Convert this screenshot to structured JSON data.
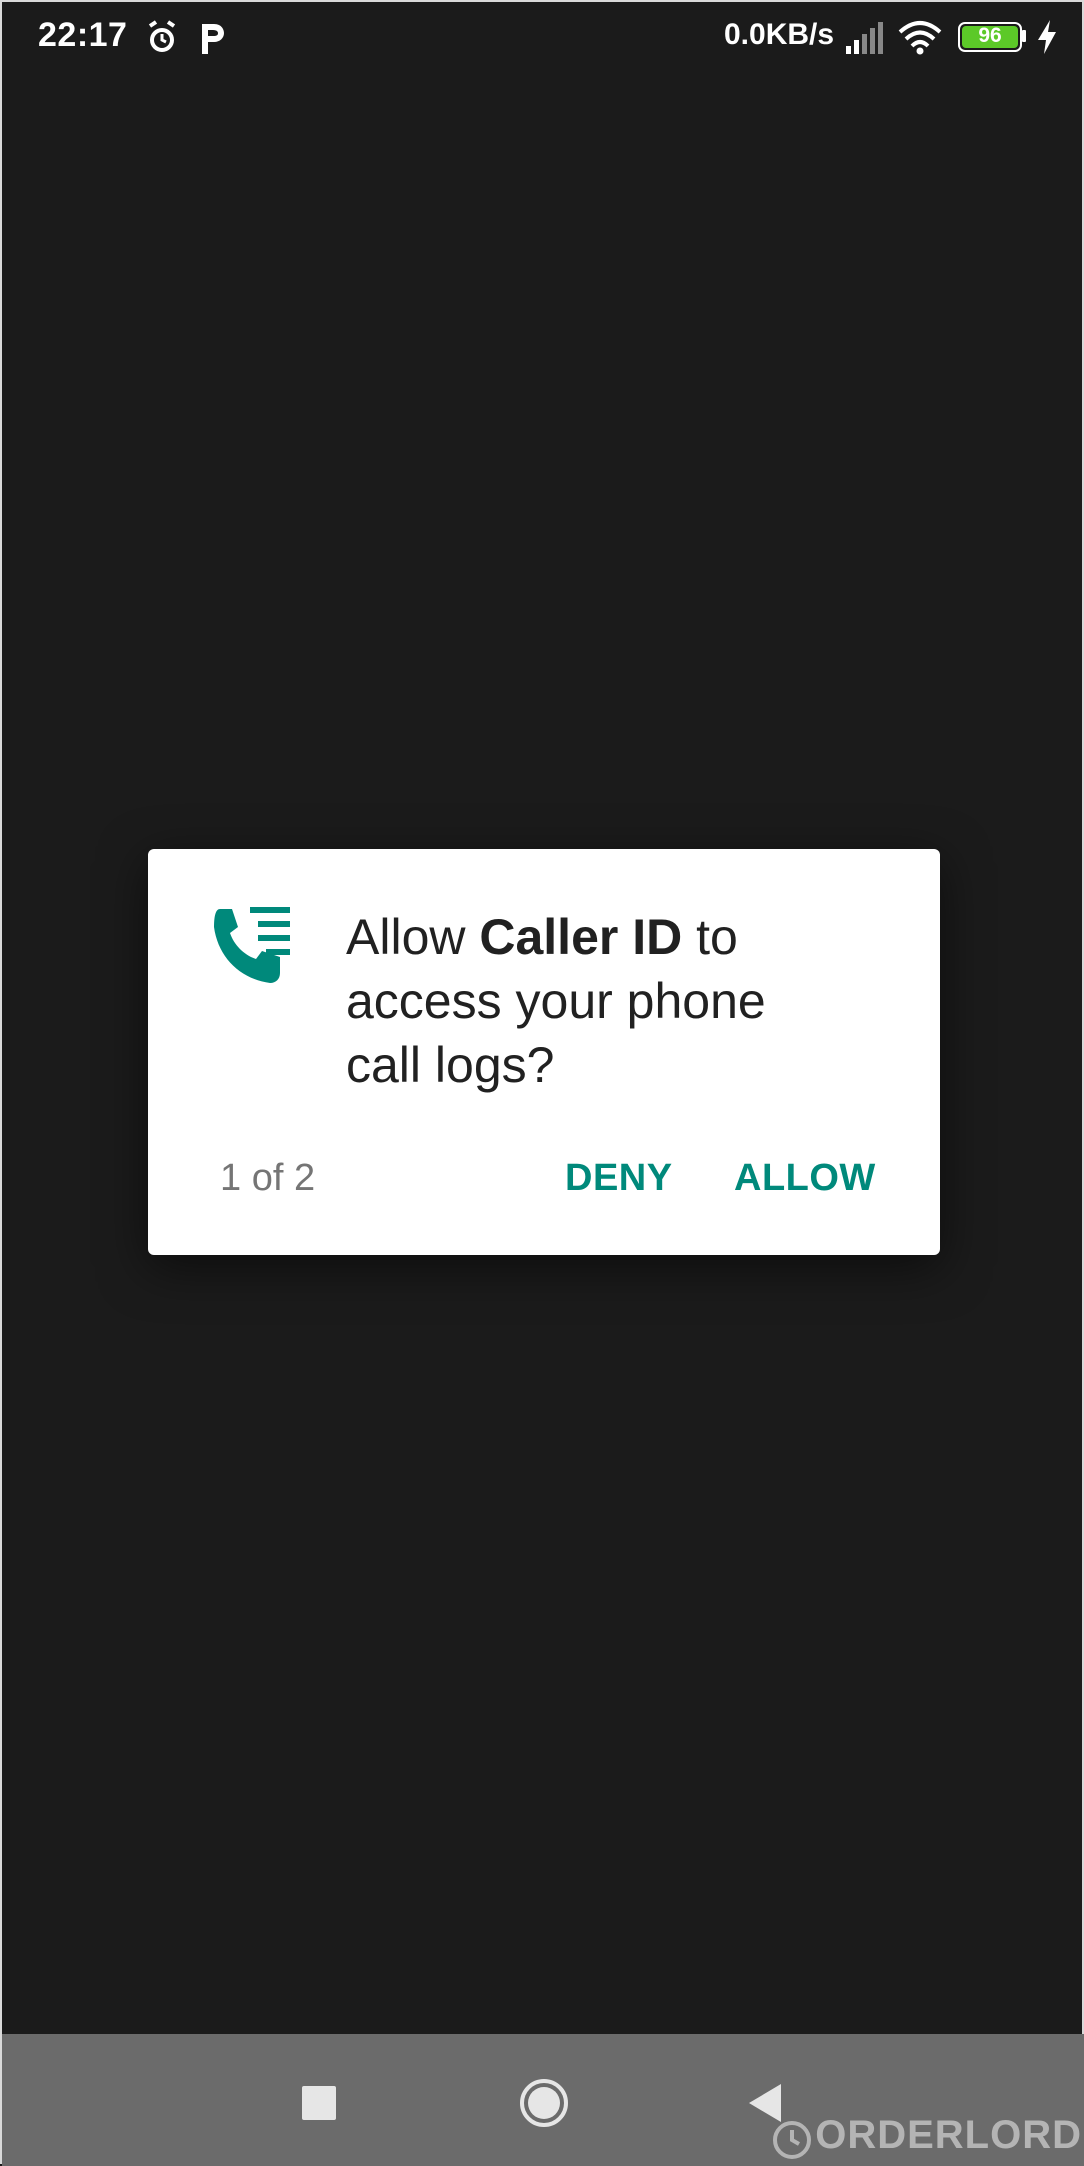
{
  "status_bar": {
    "time": "22:17",
    "network_speed": "0.0KB/s",
    "battery_level": "96",
    "icons": [
      "alarm-icon",
      "parking-app-icon",
      "signal-icon",
      "wifi-icon",
      "battery-icon",
      "charging-icon"
    ]
  },
  "dialog": {
    "icon": "call-log-icon",
    "message_prefix": "Allow ",
    "app_name": "Caller ID",
    "message_suffix_line1": " to",
    "message_line2": "access your phone",
    "message_line3": "call logs?",
    "counter": "1 of 2",
    "deny_label": "DENY",
    "allow_label": "ALLOW",
    "accent_color": "#00897b"
  },
  "nav_bar": {
    "buttons": [
      "recents-button",
      "home-button",
      "back-button"
    ]
  },
  "watermark": "ORDERLORD"
}
